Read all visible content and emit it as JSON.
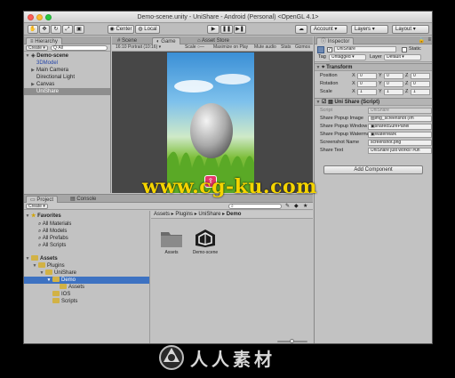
{
  "window": {
    "title": "Demo-scene.unity - UniShare - Android (Personal) <OpenGL 4.1>"
  },
  "toolbar": {
    "center_label": "Center",
    "local_label": "Local",
    "account_label": "Account",
    "layers_label": "Layers",
    "layout_label": "Layout"
  },
  "hierarchy": {
    "tab": "Hierarchy",
    "create": "Create",
    "search_placeholder": "Q·All",
    "scene": "Demo-scene",
    "items": [
      "3DModel",
      "Main Camera",
      "Directional Light",
      "Canvas",
      "UniShare"
    ]
  },
  "scene_view": {
    "scene_tab": "Scene",
    "game_tab": "Game",
    "asset_store_tab": "Asset Store",
    "resolution": "16:10 Portrait (10:16)",
    "scale_label": "Scale",
    "maximize": "Maximize on Play",
    "mute": "Mute audio",
    "stats": "Stats",
    "gizmos": "Gizmos"
  },
  "inspector": {
    "tab": "Inspector",
    "object_name": "UniShare",
    "static_label": "Static",
    "tag_label": "Tag",
    "tag_value": "Untagged",
    "layer_label": "Layer",
    "layer_value": "Default",
    "transform_title": "Transform",
    "position_label": "Position",
    "rotation_label": "Rotation",
    "scale_label": "Scale",
    "position": [
      "0",
      "0",
      "0"
    ],
    "rotation": [
      "0",
      "0",
      "0"
    ],
    "scale": [
      "1",
      "1",
      "1"
    ],
    "component_title": "Uni Share (Script)",
    "script_label": "Script",
    "script_value": "UniShare",
    "props": [
      {
        "label": "Share Popup Image",
        "value": "img_screenshot (Im"
      },
      {
        "label": "Share Popup Window",
        "value": "sharedSurePanel"
      },
      {
        "label": "Share Popup Waterma",
        "value": "WaterMark"
      },
      {
        "label": "Screenshot Name",
        "value": "screenshot.png"
      },
      {
        "label": "Share Text",
        "value": "UniShare just works! #un"
      }
    ],
    "add_component": "Add Component"
  },
  "project": {
    "project_tab": "Project",
    "console_tab": "Console",
    "create": "Create",
    "favorites": "Favorites",
    "favorite_items": [
      "All Materials",
      "All Models",
      "All Prefabs",
      "All Scripts"
    ],
    "assets_root": "Assets",
    "tree": [
      "Plugins",
      "UniShare",
      "Demo",
      "Assets",
      "IOS",
      "Scripts"
    ],
    "breadcrumb": [
      "Assets",
      "Plugins",
      "UniShare",
      "Demo"
    ],
    "files": [
      "Assets",
      "Demo-scene"
    ]
  },
  "watermark": {
    "url": "www.cg-ku.com",
    "brand": "人人素材"
  },
  "colors": {
    "selection": "#3d72c2",
    "unity_bg": "#c2c2c2"
  }
}
